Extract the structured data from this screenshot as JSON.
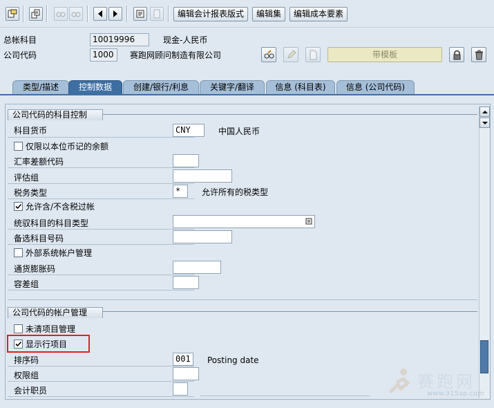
{
  "toolbar": {
    "buttons": [
      "编辑会计报表版式",
      "编辑集",
      "编辑成本要素"
    ]
  },
  "header": {
    "gl_account_label": "总帐科目",
    "gl_account_value": "10019996",
    "gl_account_desc": "现金-人民币",
    "company_code_label": "公司代码",
    "company_code_value": "1000",
    "company_code_desc": "赛跑网顾问制造有限公司",
    "template_button": "带模板"
  },
  "tabs": [
    {
      "label": "类型/描述",
      "active": false
    },
    {
      "label": "控制数据",
      "active": true
    },
    {
      "label": "创建/银行/利息",
      "active": false
    },
    {
      "label": "关键字/翻译",
      "active": false
    },
    {
      "label": "信息 (科目表)",
      "active": false
    },
    {
      "label": "信息 (公司代码)",
      "active": false
    }
  ],
  "control_group": {
    "title": "公司代码的科目控制",
    "account_currency_label": "科目货币",
    "account_currency_value": "CNY",
    "account_currency_desc": "中国人民币",
    "local_currency_only_label": "仅限以本位币记的余额",
    "local_currency_only_checked": false,
    "exchange_rate_diff_label": "汇率差额代码",
    "valuation_group_label": "评估组",
    "tax_category_label": "税务类型",
    "tax_category_value": "*",
    "tax_category_desc": "允许所有的税类型",
    "posting_without_tax_label": "允许含/不含税过帐",
    "posting_without_tax_checked": true,
    "recon_account_type_label": "统驭科目的科目类型",
    "alternative_account_label": "备选科目号码",
    "external_mgmt_label": "外部系统帐户管理",
    "external_mgmt_checked": false,
    "inflation_key_label": "通货膨胀码",
    "tolerance_group_label": "容差组"
  },
  "account_mgmt_group": {
    "title": "公司代码的帐户管理",
    "open_item_label": "未清项目管理",
    "open_item_checked": false,
    "line_item_label": "显示行项目",
    "line_item_checked": true,
    "sort_key_label": "排序码",
    "sort_key_value": "001",
    "sort_key_desc": "Posting date",
    "auth_group_label": "权限组",
    "accounting_clerk_label": "会计职员"
  },
  "watermark": {
    "text": "赛跑网",
    "url": "www.915ap.com"
  },
  "colors": {
    "background": "#dfe8f1",
    "active_tab": "#3e6fa3",
    "highlight_box": "#e0201b"
  }
}
